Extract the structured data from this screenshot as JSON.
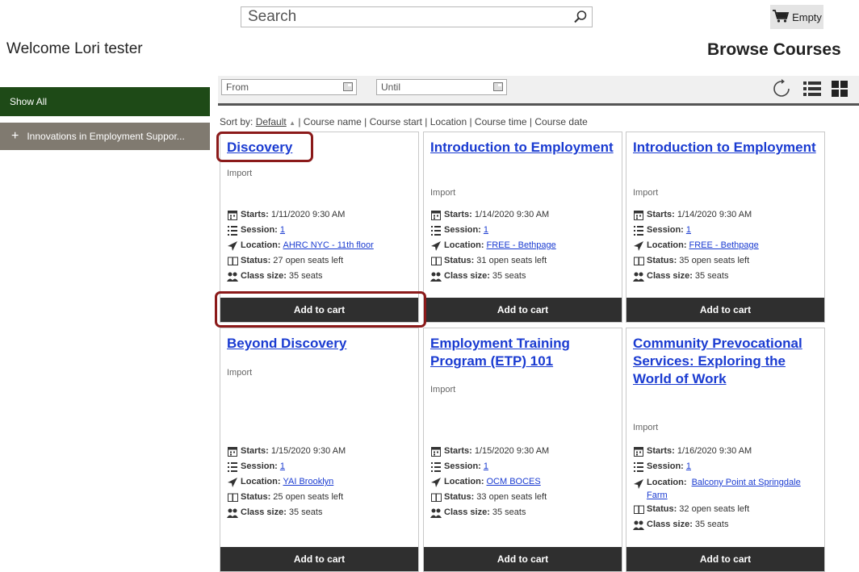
{
  "search": {
    "placeholder": "Search"
  },
  "cart": {
    "label": "Empty"
  },
  "welcome": "Welcome Lori tester",
  "page_title": "Browse Courses",
  "sidebar": {
    "show_all": "Show All",
    "categories": [
      {
        "plus": "+",
        "label": "Innovations in Employment Suppor..."
      }
    ]
  },
  "filters": {
    "from": "From",
    "until": "Until"
  },
  "sort": {
    "prefix": "Sort by:",
    "default": "Default",
    "arrow": "▲",
    "options": "| Course name | Course start | Location | Course time | Course date"
  },
  "labels": {
    "starts": "Starts:",
    "session": "Session:",
    "location": "Location:",
    "status": "Status:",
    "class_size": "Class size:",
    "add_to_cart": "Add to cart"
  },
  "courses": [
    {
      "title": "Discovery",
      "category": "Import",
      "starts": "1/11/2020 9:30 AM",
      "session": "1",
      "location": "AHRC NYC - 11th floor",
      "status": "27 open seats left",
      "class_size": "35 seats"
    },
    {
      "title": "Introduction to Employment",
      "category": "Import",
      "starts": "1/14/2020 9:30 AM",
      "session": "1",
      "location": "FREE - Bethpage",
      "status": "31 open seats left",
      "class_size": "35 seats"
    },
    {
      "title": "Introduction to Employment",
      "category": "Import",
      "starts": "1/14/2020 9:30 AM",
      "session": "1",
      "location": "FREE - Bethpage",
      "status": "35 open seats left",
      "class_size": "35 seats"
    },
    {
      "title": "Beyond Discovery",
      "category": "Import",
      "starts": "1/15/2020 9:30 AM",
      "session": "1",
      "location": "YAI Brooklyn",
      "status": "25 open seats left",
      "class_size": "35 seats"
    },
    {
      "title": "Employment Training Program (ETP) 101",
      "category": "Import",
      "starts": "1/15/2020 9:30 AM",
      "session": "1",
      "location": "OCM BOCES",
      "status": "33 open seats left",
      "class_size": "35 seats"
    },
    {
      "title": "Community Prevocational Services: Exploring the World of Work",
      "category": "Import",
      "starts": "1/16/2020 9:30 AM",
      "session": "1",
      "location": "Balcony Point at Springdale Farm",
      "status": "32 open seats left",
      "class_size": "35 seats"
    }
  ],
  "colors": {
    "sidebar_active": "#1e4a17",
    "sidebar_category": "#807a70",
    "button": "#2f2f2f",
    "link": "#1a3bd1",
    "highlight": "#8b1a1a"
  }
}
